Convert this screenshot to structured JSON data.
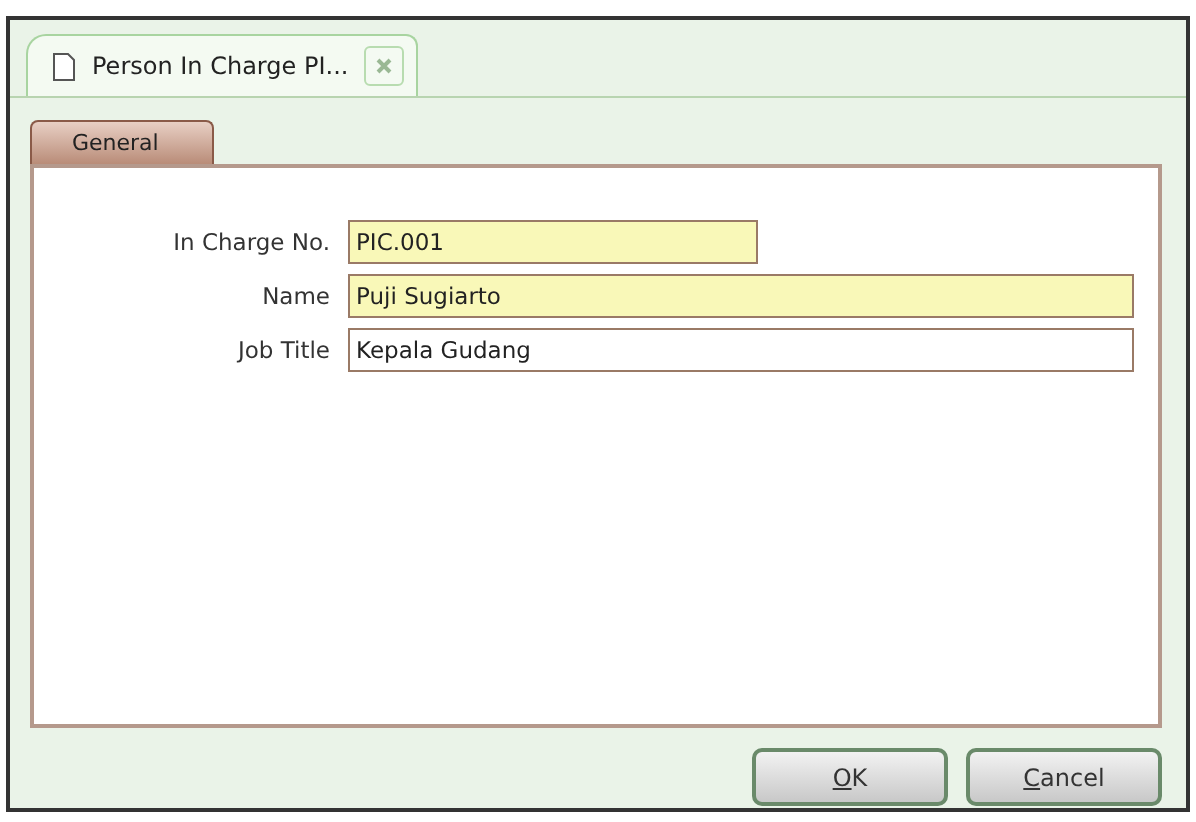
{
  "document_tab": {
    "title": "Person In Charge PI...",
    "selected": true
  },
  "tabs": [
    {
      "label": "General",
      "selected": true
    }
  ],
  "fields": [
    {
      "label": "In Charge No.",
      "value": "PIC.001",
      "required": true,
      "kind": "short"
    },
    {
      "label": "Name",
      "value": "Puji Sugiarto",
      "required": true,
      "kind": "long"
    },
    {
      "label": "Job Title",
      "value": "Kepala Gudang",
      "required": false,
      "kind": "long"
    }
  ],
  "buttons": [
    {
      "label": "OK",
      "first_letter_underlined": true
    },
    {
      "label": "Cancel",
      "first_letter_underlined": true
    }
  ]
}
